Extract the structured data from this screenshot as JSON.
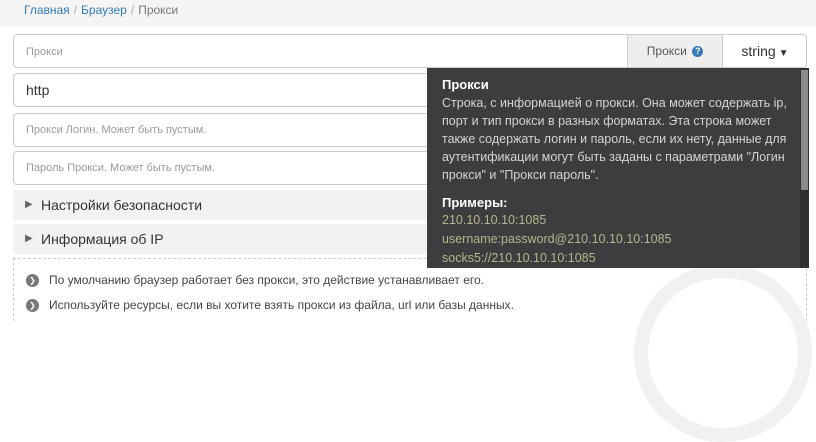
{
  "breadcrumb": {
    "home": "Главная",
    "browser": "Браузер",
    "current": "Прокси",
    "separator": "/"
  },
  "proxy_field": {
    "placeholder": "Прокси",
    "addon_label": "Прокси",
    "help_icon": "question-circle-icon",
    "type_value": "string"
  },
  "protocol_field": {
    "value": "http"
  },
  "login_field": {
    "placeholder": "Прокси Логин. Может быть пустым."
  },
  "password_field": {
    "placeholder": "Пароль Прокси. Может быть пустым."
  },
  "sections": [
    {
      "label": "Настройки безопасности"
    },
    {
      "label": "Информация об IP"
    }
  ],
  "info": [
    "По умолчанию браузер работает без прокси, это действие устанавливает его.",
    "Используйте ресурсы, если вы хотите взять прокси из файла, url или базы данных."
  ],
  "tooltip": {
    "title": "Прокси",
    "body": "Строка, с информацией о прокси. Она может содержать ip, порт и тип прокси в разных форматах. Эта строка может также содержать логин и пароль, если их нету, данные для аутентификации могут быть заданы с параметрами \"Логин прокси\" и \"Прокси пароль\".",
    "examples_title": "Примеры:",
    "examples": [
      "210.10.10.10:1085",
      "username:password@210.10.10.10:1085",
      "socks5://210.10.10.10:1085"
    ]
  },
  "colors": {
    "link": "#337ab7",
    "tooltip_bg": "#3b3d3f",
    "example_text": "#b9b58d"
  }
}
